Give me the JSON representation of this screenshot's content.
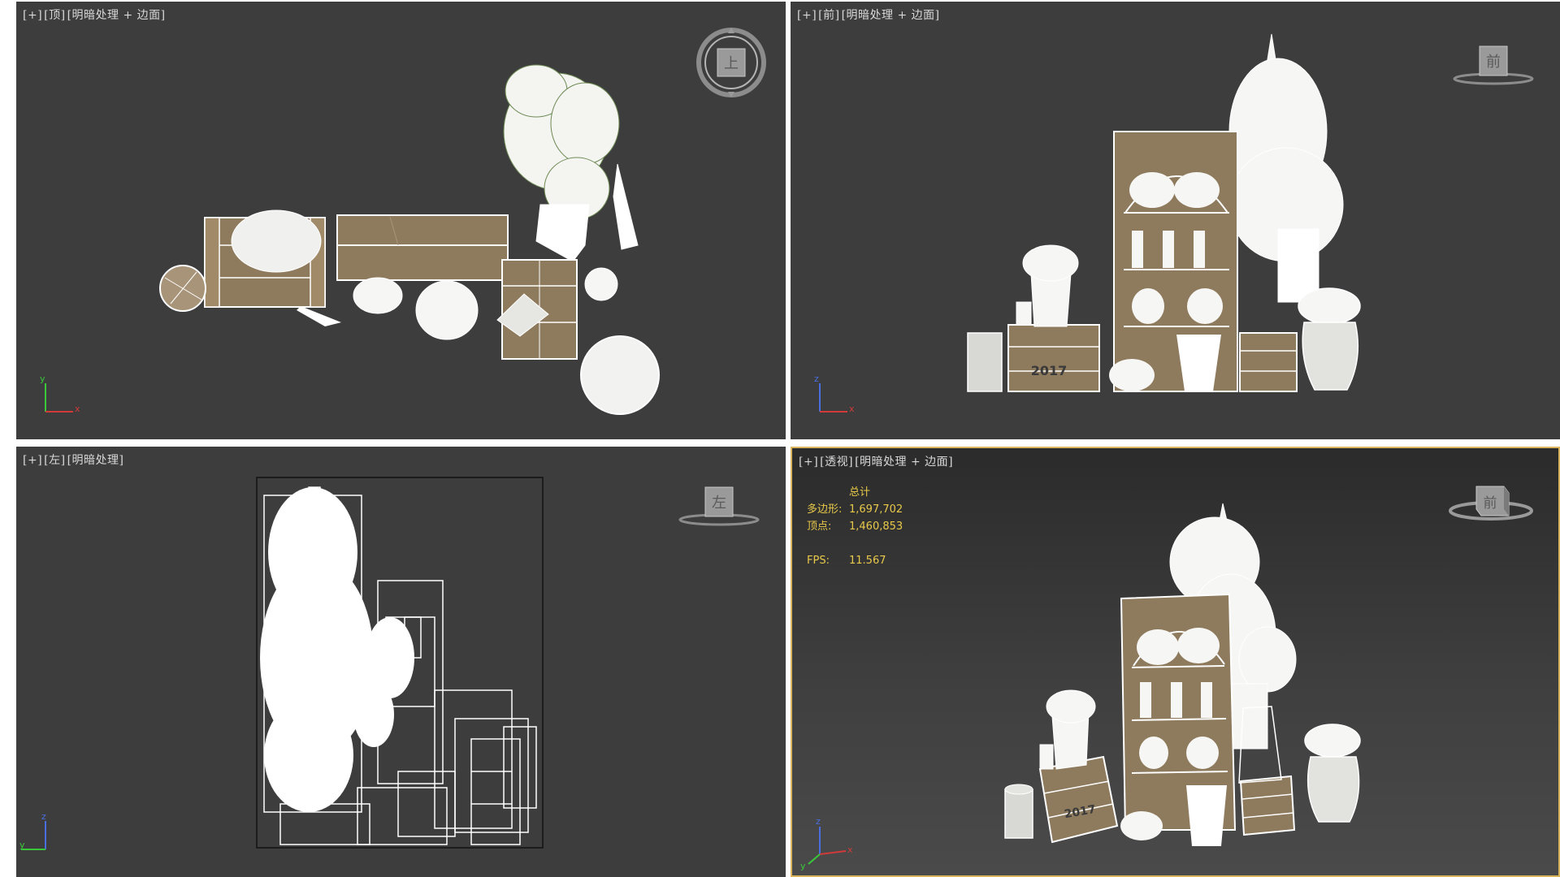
{
  "viewports": {
    "top": {
      "plus": "[+]",
      "view": "[顶]",
      "shading": "[明暗处理 + 边面]",
      "cube_label": "上"
    },
    "front": {
      "plus": "[+]",
      "view": "[前]",
      "shading": "[明暗处理 + 边面]",
      "cube_label": "前"
    },
    "left": {
      "plus": "[+]",
      "view": "[左]",
      "shading": "[明暗处理]",
      "cube_label": "左"
    },
    "perspective": {
      "plus": "[+]",
      "view": "[透视]",
      "shading": "[明暗处理 + 边面]",
      "cube_label": "前",
      "stats": {
        "header": "总计",
        "polygons_label": "多边形:",
        "polygons_value": "1,697,702",
        "vertices_label": "顶点:",
        "vertices_value": "1,460,853",
        "fps_label": "FPS:",
        "fps_value": "11.567"
      }
    }
  },
  "crate_label": "2017",
  "colors": {
    "viewport_bg": "#3d3d3d",
    "active_border": "#d9b45a",
    "stats_text": "#e8c94a",
    "wood": "#8e7a5c",
    "wire": "#ffffff",
    "axis_x": "#d23a3a",
    "axis_y": "#3ac83a",
    "axis_z": "#4a6ee0"
  }
}
